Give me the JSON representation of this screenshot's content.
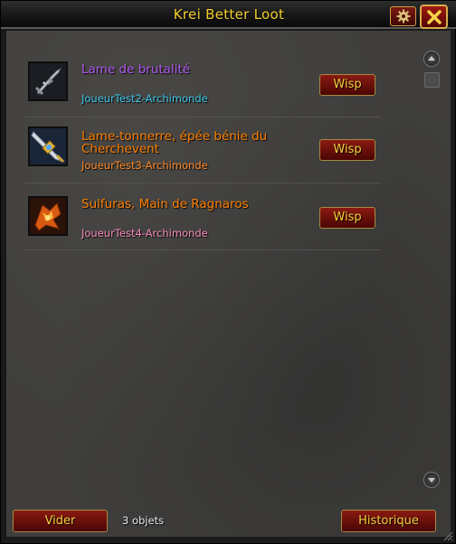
{
  "window": {
    "title": "Krei Better Loot",
    "gear_icon": "gear-icon",
    "close_icon": "close-icon"
  },
  "loot": [
    {
      "item_name": "Lame de brutalité",
      "item_color": "#b15bf0",
      "icon": "broken-sword-icon",
      "player": "JoueurTest2-Archimonde",
      "player_color": "#3fc7eb",
      "button": "Wisp"
    },
    {
      "item_name_line1": "Lame-tonnerre, épée bénie du",
      "item_name_line2": "Cherchevent",
      "item_color": "#ff8000",
      "icon": "thunderfury-sword-icon",
      "player": "JoueurTest3-Archimonde",
      "player_color": "#ff8a2b",
      "button": "Wisp"
    },
    {
      "item_name": "Sulfuras, Main de Ragnaros",
      "item_color": "#ff8000",
      "icon": "sulfuras-hammer-icon",
      "player": "JoueurTest4-Archimonde",
      "player_color": "#f48cba",
      "button": "Wisp"
    }
  ],
  "footer": {
    "clear_label": "Vider",
    "count": "3 objets",
    "history_label": "Historique"
  }
}
